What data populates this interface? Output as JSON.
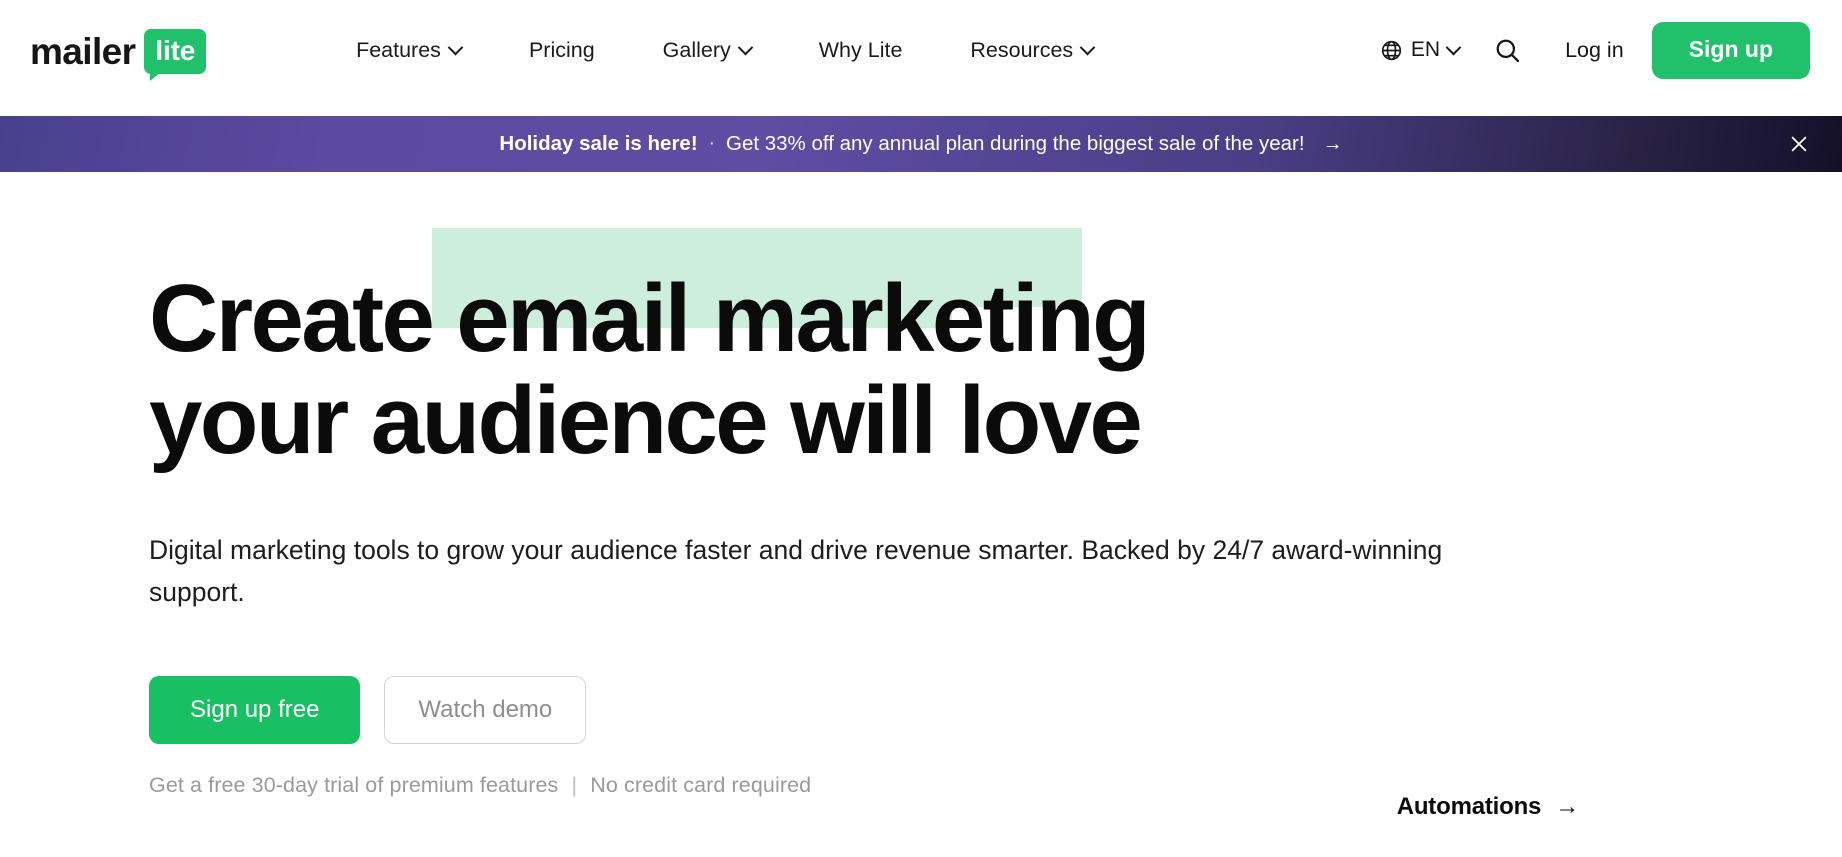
{
  "brand": {
    "logo_primary": "mailer",
    "logo_badge": "lite",
    "green": "#21c16b",
    "highlight_green": "#cdeedc"
  },
  "header": {
    "nav": [
      {
        "label": "Features",
        "has_dropdown": true
      },
      {
        "label": "Pricing",
        "has_dropdown": false
      },
      {
        "label": "Gallery",
        "has_dropdown": true
      },
      {
        "label": "Why Lite",
        "has_dropdown": false
      },
      {
        "label": "Resources",
        "has_dropdown": true
      }
    ],
    "language": {
      "code": "EN",
      "icon": "globe-icon"
    },
    "search_icon": "search-icon",
    "login_label": "Log in",
    "signup_label": "Sign up"
  },
  "banner": {
    "strong": "Holiday sale is here!",
    "separator": "·",
    "text": "Get 33% off any annual plan during the biggest sale of the year!",
    "arrow": "→",
    "close_icon": "close-icon",
    "gradient_from": "#4a3f8f",
    "gradient_to": "#141029"
  },
  "hero": {
    "headline_part1": "Create",
    "headline_highlight": "email marketing",
    "headline_part2": "your audience will love",
    "lede": "Digital marketing tools to grow your audience faster and drive revenue smarter. Backed by 24/7 award-winning support.",
    "primary_cta": "Sign up free",
    "secondary_cta": "Watch demo",
    "fineprint_left": "Get a free 30-day trial of premium features",
    "fineprint_sep": "|",
    "fineprint_right": "No credit card required",
    "feature_link": "Automations",
    "feature_link_arrow": "→"
  }
}
